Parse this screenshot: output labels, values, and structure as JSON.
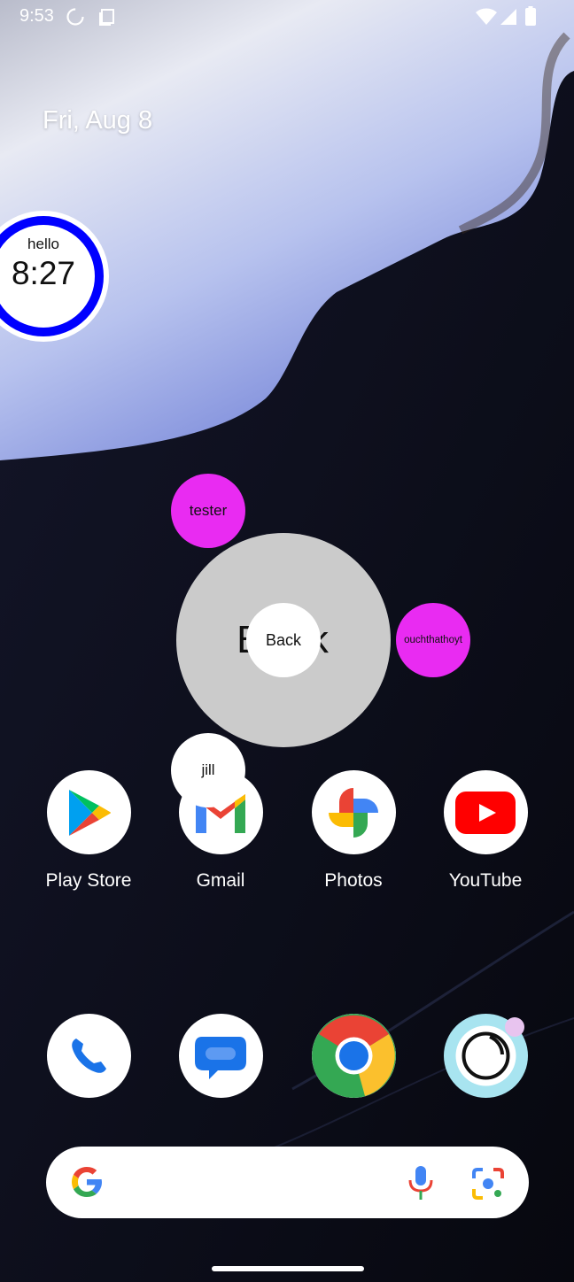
{
  "status_bar": {
    "time": "9:53",
    "icons": [
      "sync-icon",
      "screenshot-icon",
      "wifi-icon",
      "signal-icon",
      "battery-icon"
    ]
  },
  "date": "Fri, Aug 8",
  "clock_widget": {
    "label": "hello",
    "time": "8:27",
    "ring_color": "#0000ff"
  },
  "bubbles": {
    "tester": "tester",
    "ouch": "ouchthathoyt",
    "back": "Back",
    "big_text": "Back",
    "jill": "jill",
    "accent": "#e92bf2"
  },
  "apps_row1": [
    {
      "label": "Play Store",
      "icon": "play-store-icon"
    },
    {
      "label": "Gmail",
      "icon": "gmail-icon"
    },
    {
      "label": "Photos",
      "icon": "photos-icon"
    },
    {
      "label": "YouTube",
      "icon": "youtube-icon"
    }
  ],
  "dock": [
    {
      "icon": "phone-icon"
    },
    {
      "icon": "messages-icon"
    },
    {
      "icon": "chrome-icon"
    },
    {
      "icon": "camera-icon"
    }
  ],
  "search_bar": {
    "icons": [
      "google-g-icon",
      "microphone-icon",
      "lens-icon"
    ]
  }
}
